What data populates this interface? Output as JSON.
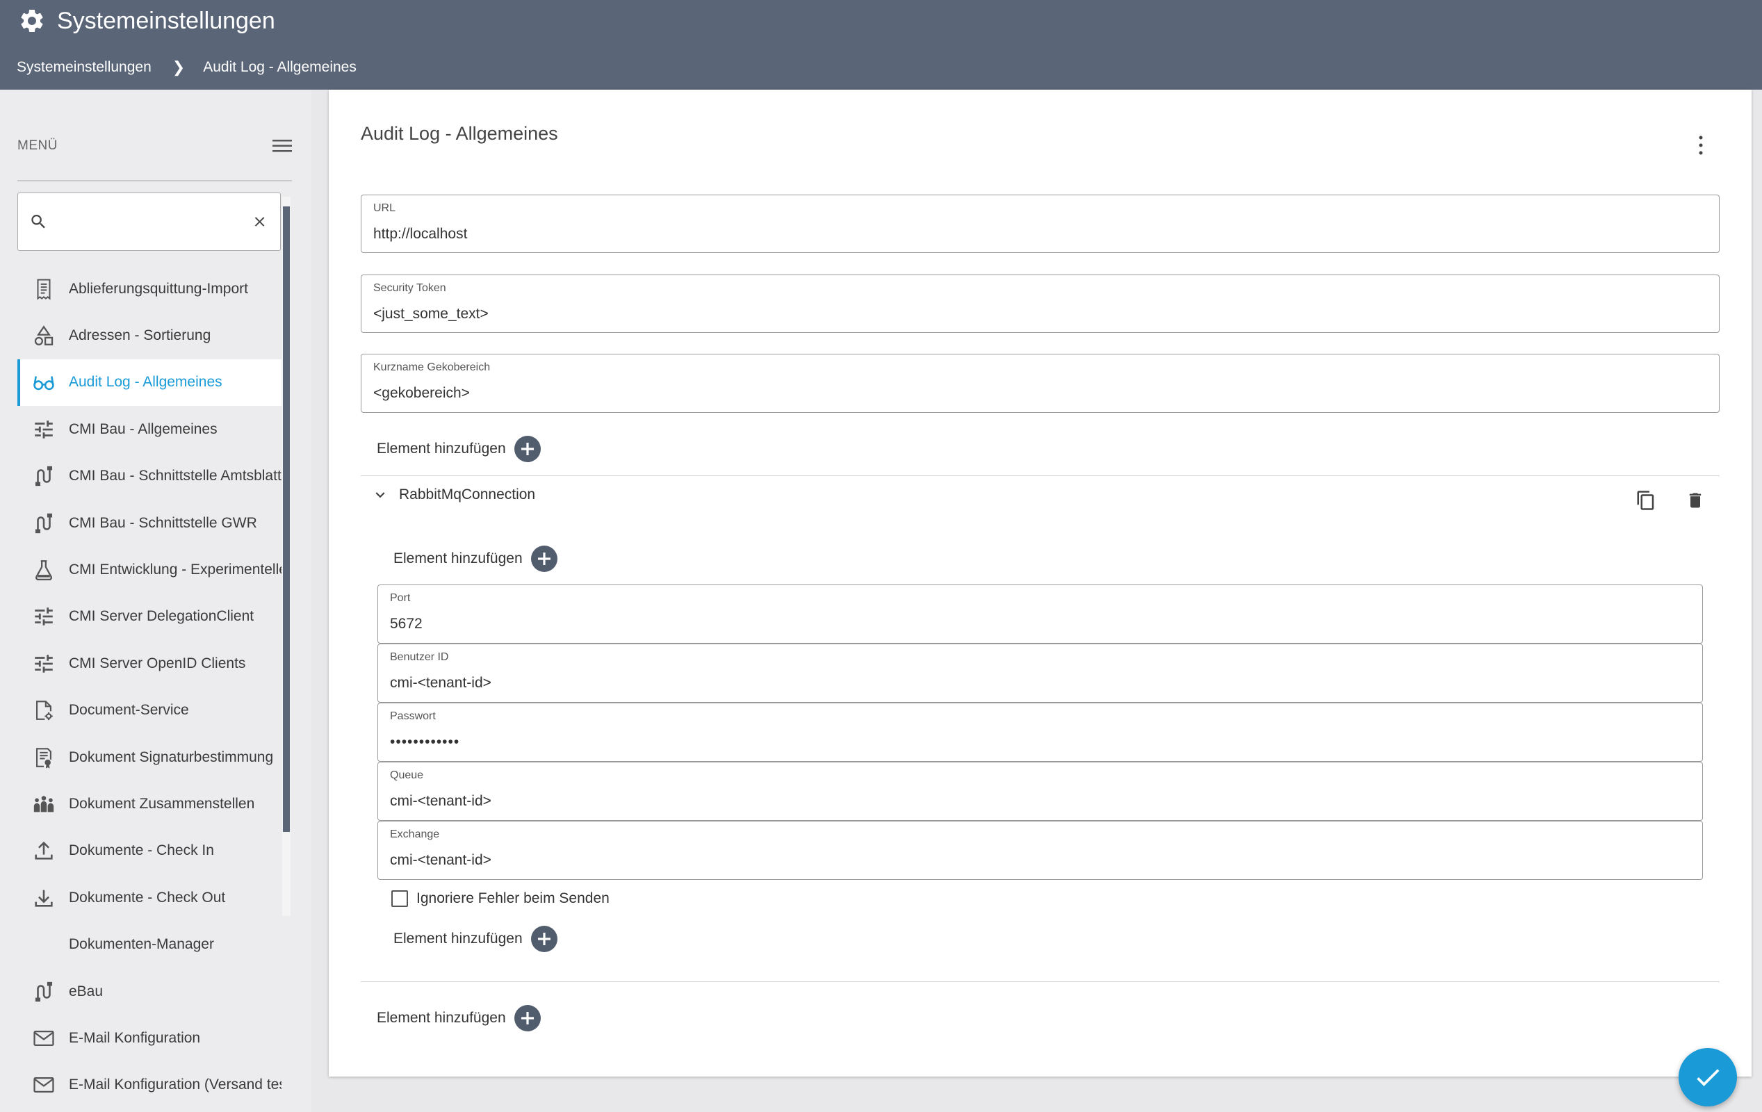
{
  "header": {
    "title": "Systemeinstellungen",
    "breadcrumb": [
      "Systemeinstellungen",
      "Audit Log - Allgemeines"
    ]
  },
  "sidebar": {
    "menu_label": "MENÜ",
    "search": {
      "value": "",
      "placeholder": ""
    },
    "items": [
      {
        "label": "Ablieferungsquittung-Import",
        "icon": "receipt-icon"
      },
      {
        "label": "Adressen - Sortierung",
        "icon": "shapes-icon"
      },
      {
        "label": "Audit Log - Allgemeines",
        "icon": "glasses-icon",
        "active": true
      },
      {
        "label": "CMI Bau - Allgemeines",
        "icon": "tune-icon"
      },
      {
        "label": "CMI Bau - Schnittstelle Amtsblatt",
        "icon": "route-icon"
      },
      {
        "label": "CMI Bau - Schnittstelle GWR",
        "icon": "route-icon"
      },
      {
        "label": "CMI Entwicklung - Experimentelle",
        "icon": "flask-icon"
      },
      {
        "label": "CMI Server DelegationClient",
        "icon": "tune-icon"
      },
      {
        "label": "CMI Server OpenID Clients",
        "icon": "tune-icon"
      },
      {
        "label": "Document-Service",
        "icon": "document-gear-icon"
      },
      {
        "label": "Dokument Signaturbestimmung",
        "icon": "certificate-icon"
      },
      {
        "label": "Dokument Zusammenstellen",
        "icon": "group-icon"
      },
      {
        "label": "Dokumente - Check In",
        "icon": "upload-icon"
      },
      {
        "label": "Dokumente - Check Out",
        "icon": "download-icon"
      },
      {
        "label": "Dokumenten-Manager",
        "icon": ""
      },
      {
        "label": "eBau",
        "icon": "route-icon"
      },
      {
        "label": "E-Mail Konfiguration",
        "icon": "mail-icon"
      },
      {
        "label": "E-Mail Konfiguration (Versand test",
        "icon": "mail-icon"
      }
    ]
  },
  "main": {
    "title": "Audit Log - Allgemeines",
    "fields": [
      {
        "label": "URL",
        "value": "http://localhost"
      },
      {
        "label": "Security Token",
        "value": "<just_some_text>"
      },
      {
        "label": "Kurzname Gekobereich",
        "value": "<gekobereich>"
      }
    ],
    "add_element_label": "Element hinzufügen",
    "section": {
      "name": "RabbitMqConnection",
      "fields": [
        {
          "label": "Port",
          "value": "5672"
        },
        {
          "label": "Benutzer ID",
          "value": "cmi-<tenant-id>"
        },
        {
          "label": "Passwort",
          "value": "••••••••••••"
        },
        {
          "label": "Queue",
          "value": "cmi-<tenant-id>"
        },
        {
          "label": "Exchange",
          "value": "cmi-<tenant-id>"
        }
      ],
      "checkbox_label": "Ignoriere Fehler beim Senden",
      "checkbox_checked": false
    }
  },
  "colors": {
    "header_bg": "#5a6577",
    "accent": "#1a9bd7",
    "sidebar_bg": "#ececee"
  }
}
